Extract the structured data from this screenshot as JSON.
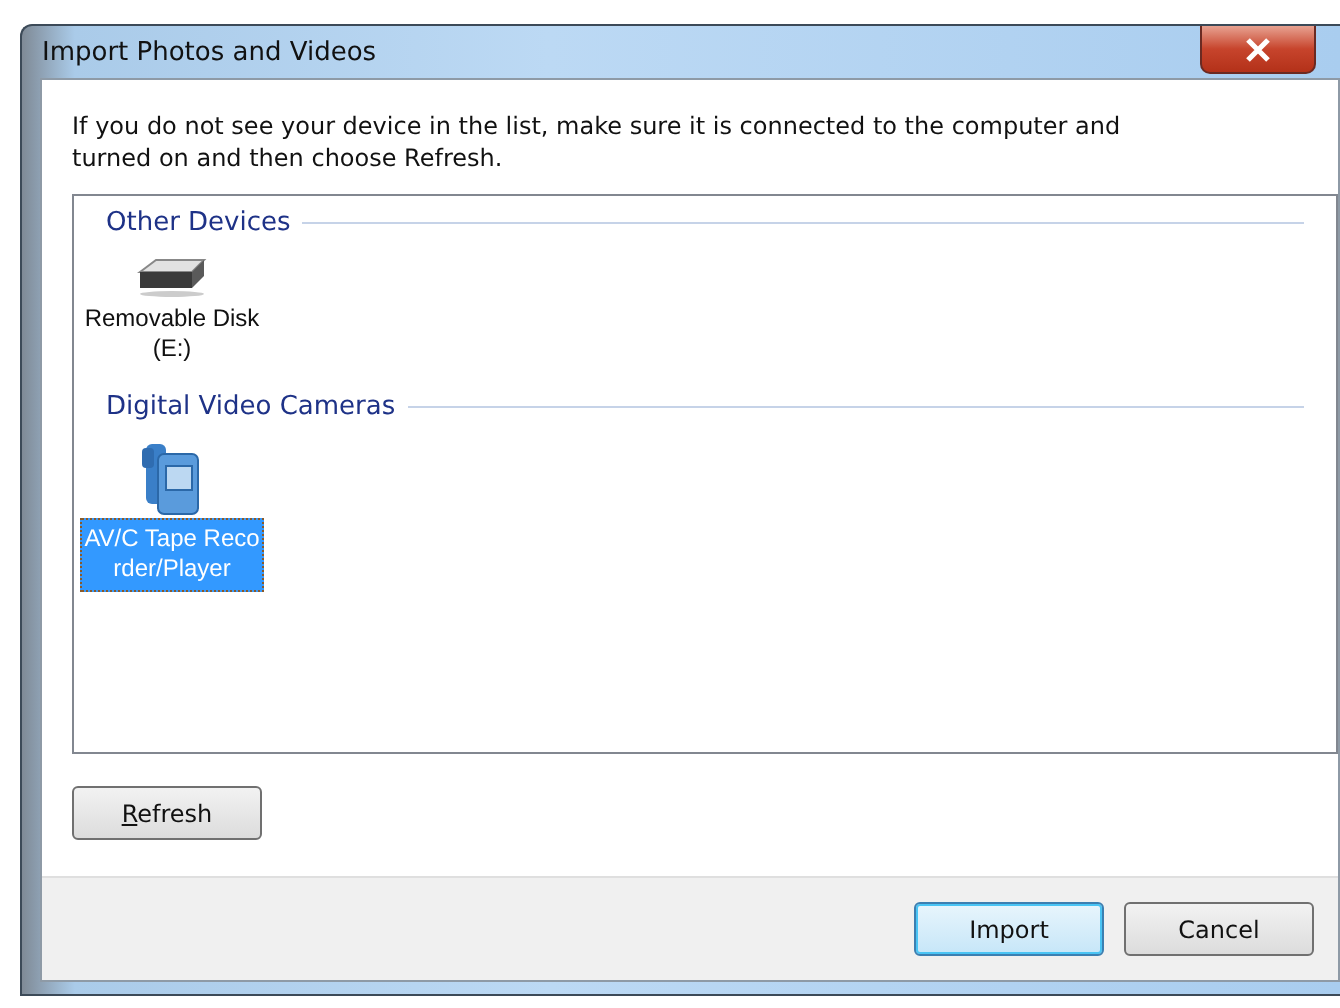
{
  "window": {
    "title": "Import Photos and Videos"
  },
  "instructions": "If you do not see your device in the list, make sure it is connected to the computer and turned on and then choose Refresh.",
  "groups": [
    {
      "heading": "Other Devices",
      "devices": [
        {
          "kind": "disk",
          "label": "Removable Disk (E:)",
          "selected": false
        }
      ]
    },
    {
      "heading": "Digital Video Cameras",
      "devices": [
        {
          "kind": "camera",
          "label": "AV/C Tape Recorder/Player",
          "selected": true
        }
      ]
    }
  ],
  "refresh_button": {
    "label": "Refresh",
    "mnemonic_first": true
  },
  "buttons": [
    {
      "label": "Import",
      "default": true
    },
    {
      "label": "Cancel",
      "default": false
    }
  ]
}
